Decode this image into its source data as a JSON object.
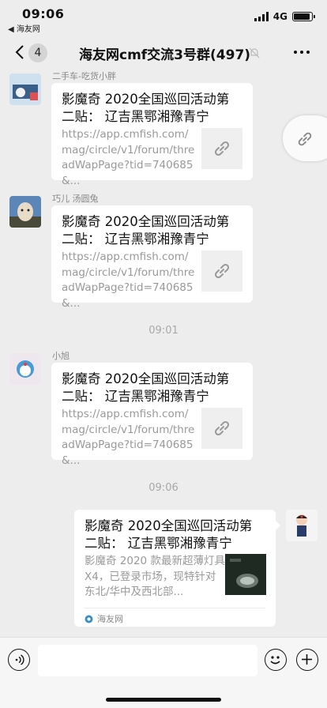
{
  "status_bar": {
    "time": "09:06",
    "back_app": "◀ 海友网",
    "network": "4G"
  },
  "nav": {
    "unread_count": "4",
    "title": "海友网cmf交流3号群(497)"
  },
  "messages": [
    {
      "sender": "二手车-吃货小胖",
      "title": "影魔奇 2020全国巡回活动第二贴： 辽吉黑鄂湘豫青宁",
      "desc": "https://app.cmfish.com/mag/circle/v1/forum/threadWapPage?tid=740685&..."
    },
    {
      "sender": "巧儿 汤圆兔",
      "title": "影魔奇 2020全国巡回活动第二贴： 辽吉黑鄂湘豫青宁",
      "desc": "https://app.cmfish.com/mag/circle/v1/forum/threadWapPage?tid=740685&..."
    },
    {
      "sender": "小旭",
      "title": "影魔奇 2020全国巡回活动第二贴： 辽吉黑鄂湘豫青宁",
      "desc": "https://app.cmfish.com/mag/circle/v1/forum/threadWapPage?tid=740685&..."
    }
  ],
  "timestamps": [
    "09:01",
    "09:06"
  ],
  "outgoing": {
    "title": "影魔奇 2020全国巡回活动第二贴： 辽吉黑鄂湘豫青宁",
    "desc": "影魔奇 2020 款最新超薄灯具 X4，已登录市场，现特针对东北/华中及西北部...",
    "source": "海友网"
  }
}
